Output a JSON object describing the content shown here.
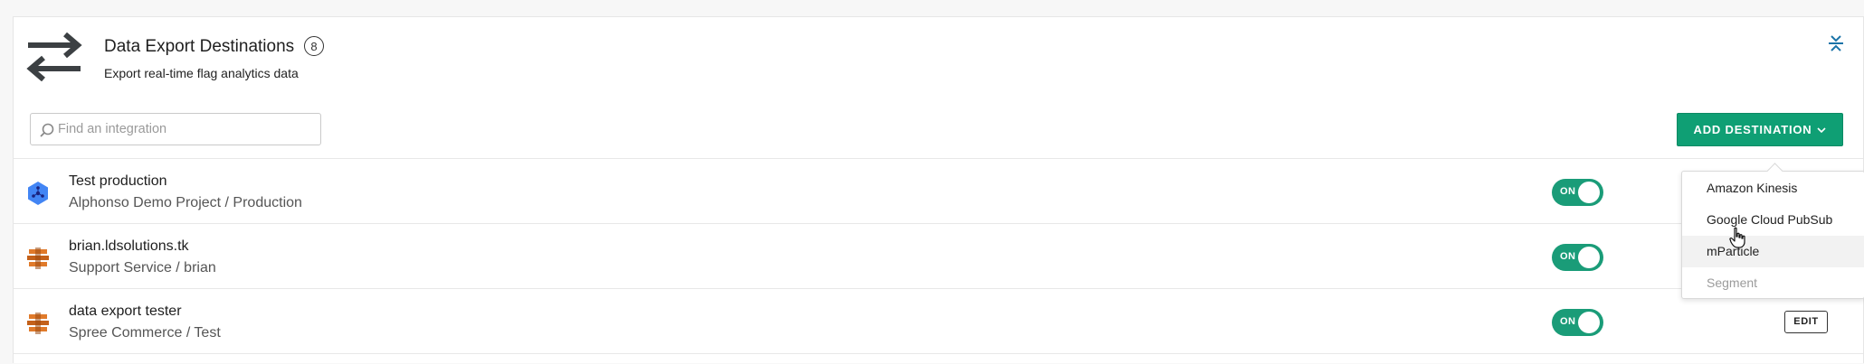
{
  "header": {
    "title": "Data Export Destinations",
    "count": "8",
    "subtitle": "Export real-time flag analytics data",
    "icon": "swap-arrows-icon",
    "collapse_icon": "collapse-icon"
  },
  "search": {
    "placeholder": "Find an integration",
    "value": ""
  },
  "add_button": {
    "label": "ADD DESTINATION",
    "color": "#0f9f74"
  },
  "dropdown": {
    "items": [
      {
        "label": "Amazon Kinesis",
        "state": "normal"
      },
      {
        "label": "Google Cloud PubSub",
        "state": "normal"
      },
      {
        "label": "mParticle",
        "state": "hover"
      },
      {
        "label": "Segment",
        "state": "disabled"
      }
    ]
  },
  "destinations": [
    {
      "name": "Test production",
      "subtitle": "Alphonso Demo Project / Production",
      "icon": "google-pubsub-icon",
      "toggle": "ON",
      "enabled": true
    },
    {
      "name": "brian.ldsolutions.tk",
      "subtitle": "Support Service / brian",
      "icon": "aws-kinesis-icon",
      "toggle": "ON",
      "enabled": true
    },
    {
      "name": "data export tester",
      "subtitle": "Spree Commerce / Test",
      "icon": "aws-kinesis-icon",
      "toggle": "ON",
      "enabled": true,
      "edit_label": "EDIT"
    }
  ],
  "colors": {
    "toggle_on": "#1a9c78",
    "pubsub_blue": "#4285f4",
    "kinesis_orange": "#e07a2a"
  }
}
